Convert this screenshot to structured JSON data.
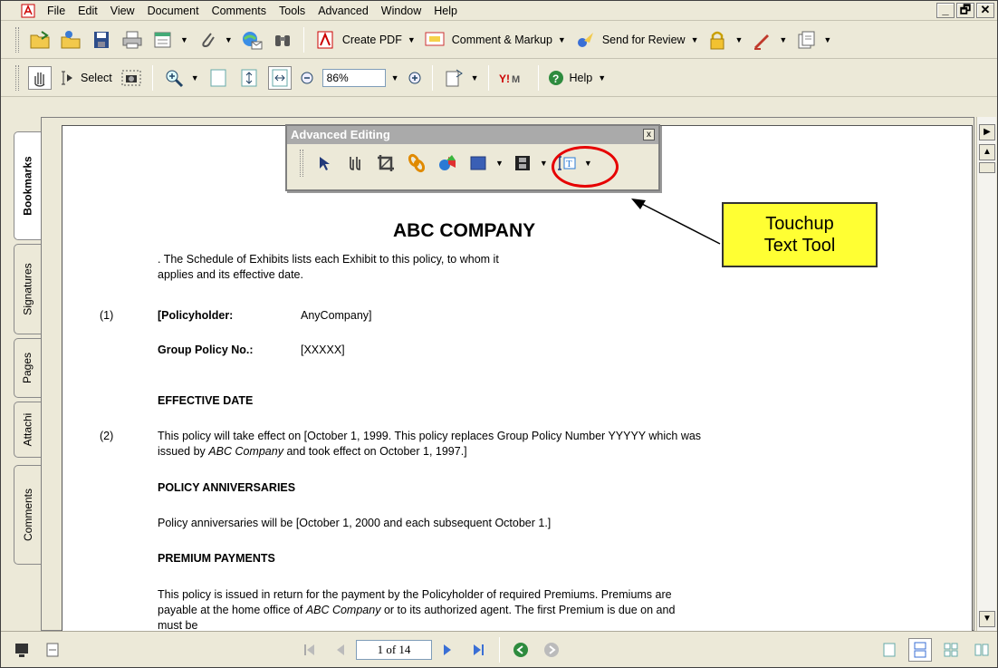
{
  "menu": [
    "File",
    "Edit",
    "View",
    "Document",
    "Comments",
    "Tools",
    "Advanced",
    "Window",
    "Help"
  ],
  "window_controls": [
    "_",
    "🗗",
    "✕"
  ],
  "toolbar1": {
    "create_pdf": "Create PDF",
    "comment_markup": "Comment & Markup",
    "send_review": "Send for Review"
  },
  "toolbar2": {
    "select": "Select",
    "zoom": "86%",
    "help": "Help"
  },
  "side_tabs": [
    "Bookmarks",
    "Signatures",
    "Pages",
    "Attachi",
    "Comments"
  ],
  "advanced_editing": {
    "title": "Advanced Editing",
    "close": "x"
  },
  "callout": {
    "line1": "Touchup",
    "line2": "Text Tool"
  },
  "document": {
    "title": "ABC COMPANY",
    "intro_line1": ". The Schedule of Exhibits lists each Exhibit to this policy, to whom it",
    "intro_line2": "applies and its effective date.",
    "item1_num": "(1)",
    "policyholder_label": "[Policyholder:",
    "policyholder_value": "AnyCompany]",
    "group_policy_label": "Group Policy No.:",
    "group_policy_value": "[XXXXX]",
    "effective_heading": "EFFECTIVE DATE",
    "item2_num": "(2)",
    "effective_line1": "This policy will take effect on [October 1, 1999.  This policy replaces Group Policy Number YYYYY which was",
    "effective_line2_pre": "issued by ",
    "effective_line2_em": "ABC Company",
    "effective_line2_post": " and took effect on October 1, 1997.]",
    "anniv_heading": "POLICY ANNIVERSARIES",
    "anniv_text": "Policy anniversaries will be [October 1, 2000 and each subsequent October 1.]",
    "premium_heading": "PREMIUM PAYMENTS",
    "premium_line1": "This policy is issued in return for the payment by the Policyholder of required Premiums.  Premiums are",
    "premium_line2_pre": "payable at the home office of ",
    "premium_line2_em": "ABC Company",
    "premium_line2_post": " or to its authorized agent.  The first Premium is due on and",
    "premium_line3": "must be"
  },
  "status": {
    "page_indicator": "1 of 14"
  }
}
